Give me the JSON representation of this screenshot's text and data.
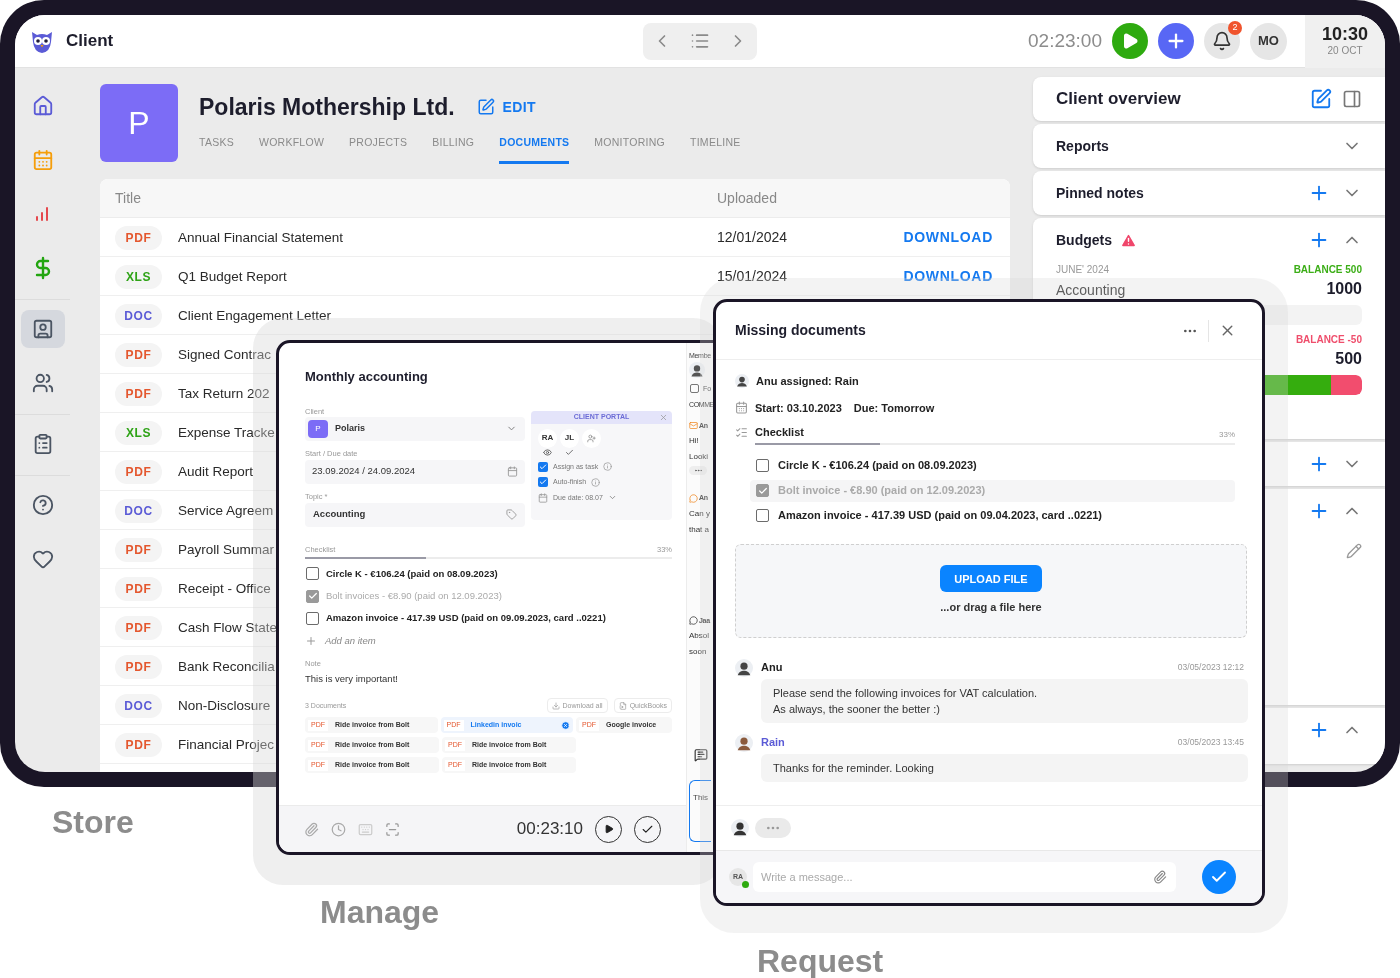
{
  "app": {
    "title": "Client",
    "timer": "02:23:00",
    "notifications": "2",
    "user_initials": "MO",
    "clock": {
      "time": "10:30",
      "date": "20 OCT"
    }
  },
  "sidebar": {
    "groups": [
      {
        "items": [
          {
            "kind": "home",
            "selected": false
          },
          {
            "kind": "calendar",
            "selected": false
          },
          {
            "kind": "chart",
            "selected": false
          },
          {
            "kind": "money",
            "selected": false
          }
        ]
      },
      {
        "items": [
          {
            "kind": "contact",
            "selected": true
          },
          {
            "kind": "people",
            "selected": false
          }
        ]
      },
      {
        "items": [
          {
            "kind": "clipboard",
            "selected": false
          }
        ]
      },
      {
        "items": [
          {
            "kind": "help",
            "selected": false
          },
          {
            "kind": "heart",
            "selected": false
          }
        ]
      }
    ]
  },
  "client": {
    "initial": "P",
    "name": "Polaris Mothership Ltd.",
    "edit": "EDIT",
    "tabs": [
      {
        "label": "TASKS",
        "selected": false
      },
      {
        "label": "WORKFLOW",
        "selected": false
      },
      {
        "label": "PROJECTS",
        "selected": false
      },
      {
        "label": "BILLING",
        "selected": false
      },
      {
        "label": "DOCUMENTS",
        "selected": true
      },
      {
        "label": "MONITORING",
        "selected": false
      },
      {
        "label": "TIMELINE",
        "selected": false
      }
    ]
  },
  "documents": {
    "columns": [
      "Title",
      "Uploaded"
    ],
    "rows": [
      {
        "kind": "pdf",
        "type": "PDF",
        "title": "Annual Financial Statement",
        "uploaded": "12/01/2024",
        "action": "DOWNLOAD"
      },
      {
        "kind": "xls",
        "type": "XLS",
        "title": "Q1 Budget Report",
        "uploaded": "15/01/2024",
        "action": "DOWNLOAD"
      },
      {
        "kind": "doc",
        "type": "DOC",
        "title": "Client Engagement Letter"
      },
      {
        "kind": "pdf",
        "type": "PDF",
        "title": "Signed Contrac"
      },
      {
        "kind": "pdf",
        "type": "PDF",
        "title": "Tax Return 202"
      },
      {
        "kind": "xls",
        "type": "XLS",
        "title": "Expense Tracke"
      },
      {
        "kind": "pdf",
        "type": "PDF",
        "title": "Audit Report"
      },
      {
        "kind": "doc",
        "type": "DOC",
        "title": "Service Agreem"
      },
      {
        "kind": "pdf",
        "type": "PDF",
        "title": "Payroll Summar"
      },
      {
        "kind": "pdf",
        "type": "PDF",
        "title": "Receipt - Office"
      },
      {
        "kind": "pdf",
        "type": "PDF",
        "title": "Cash Flow State"
      },
      {
        "kind": "pdf",
        "type": "PDF",
        "title": "Bank Reconcilia"
      },
      {
        "kind": "doc",
        "type": "DOC",
        "title": "Non-Disclosure"
      },
      {
        "kind": "pdf",
        "type": "PDF",
        "title": "Financial Projec"
      }
    ]
  },
  "overview": {
    "title": "Client overview",
    "sections": [
      {
        "kind": "plain",
        "title": "Reports",
        "expanded": false,
        "addable": false
      },
      {
        "kind": "plain",
        "title": "Pinned notes",
        "expanded": false,
        "addable": true
      },
      {
        "kind": "budgets",
        "title": "Budgets",
        "warning": true,
        "expanded": true,
        "addable": true,
        "items": [
          {
            "period": "JUNE' 2024",
            "name": "Accounting",
            "balance": "BALANCE 500",
            "amount": "1000",
            "negative": false
          },
          {
            "balance": "BALANCE -50",
            "amount": "500",
            "negative": true,
            "level": 0.9
          }
        ]
      },
      {
        "kind": "plain",
        "expanded": false,
        "addable": true
      },
      {
        "kind": "plain",
        "expanded": true,
        "addable": true,
        "editable": true
      },
      {
        "kind": "plain",
        "expanded": true,
        "addable": true
      }
    ]
  },
  "task": {
    "title": "Monthly accounting",
    "client_label": "Client",
    "client": {
      "initial": "P",
      "name": "Polaris"
    },
    "date_label": "Start / Due date",
    "dates": "23.09.2024 / 24.09.2024",
    "topic_label": "Topic *",
    "topic": "Accounting",
    "portal": {
      "title": "CLIENT PORTAL",
      "members": [
        {
          "initials": "RA",
          "kind": "viewed"
        },
        {
          "initials": "JL",
          "kind": "done"
        }
      ],
      "options": [
        {
          "label": "Assign as task",
          "checked": true
        },
        {
          "label": "Auto-finish",
          "checked": true
        }
      ],
      "due": "Due date: 08.07"
    },
    "checklist": {
      "label": "Checklist",
      "percent": "33%",
      "level": 0.33,
      "items": [
        {
          "text": "Circle K - €106.24 (paid on 08.09.2023)",
          "checked": false
        },
        {
          "text": "Bolt invoices - €8.90 (paid on 12.09.2023)",
          "checked": true
        },
        {
          "text": "Amazon invoice - 417.39 USD (paid on 09.09.2023, card ..0221)",
          "checked": false
        }
      ],
      "add": "Add an item"
    },
    "note_label": "Note",
    "note": "This is very important!",
    "files": {
      "count": "3 Documents",
      "actions": [
        {
          "kind": "download",
          "label": "Download all"
        },
        {
          "kind": "export",
          "label": "QuickBooks"
        }
      ],
      "rows": [
        {
          "items": [
            {
              "type": "PDF",
              "name": "Ride invoice from Bolt",
              "highlighted": false
            },
            {
              "type": "PDF",
              "name": "Linkedin invoic",
              "highlighted": true
            },
            {
              "type": "PDF",
              "name": "Google invoice",
              "highlighted": false
            }
          ]
        },
        {
          "items": [
            {
              "type": "PDF",
              "name": "Ride invoice from Bolt",
              "highlighted": false
            },
            {
              "type": "PDF",
              "name": "Ride invoice from Bolt",
              "highlighted": false
            }
          ]
        },
        {
          "items": [
            {
              "type": "PDF",
              "name": "Ride invoice from Bolt",
              "highlighted": false
            },
            {
              "type": "PDF",
              "name": "Ride invoice from Bolt",
              "highlighted": false
            }
          ]
        }
      ]
    },
    "timer": "00:23:10",
    "side": {
      "label": "Membe",
      "option": "Fo",
      "option_checked": false,
      "section": "COMME",
      "comments": [
        {
          "kind": "mail",
          "author": "An",
          "lines": [
            "Hi!",
            "Looki"
          ],
          "more": true
        },
        {
          "kind": "comment",
          "author": "An",
          "lines": [
            "Can y",
            "that a"
          ],
          "more": false
        },
        {
          "kind": "comment",
          "author": "Jaa",
          "lines": [
            "Absol",
            "soon"
          ],
          "more": false
        }
      ],
      "input": "This"
    }
  },
  "request": {
    "title": "Missing documents",
    "assigned": "Anu assigned: Rain",
    "start": "Start: 03.10.2023",
    "due": "Due: Tomorrow",
    "checklist": {
      "label": "Checklist",
      "percent": "33%",
      "level": 0.26,
      "items": [
        {
          "text": "Circle K - €106.24 (paid on 08.09.2023)",
          "checked": false
        },
        {
          "text": "Bolt invoice - €8.90 (paid on 12.09.2023)",
          "checked": true
        },
        {
          "text": "Amazon invoice - 417.39 USD (paid on 09.04.2023, card ..0221)",
          "checked": false
        }
      ]
    },
    "upload": {
      "button": "UPLOAD FILE",
      "hint": "...or drag a file here"
    },
    "messages": [
      {
        "author": "Anu",
        "self": false,
        "time": "03/05/2023 12:12",
        "lines": [
          "Please send the following invoices for VAT calculation.",
          "As always, the sooner the better :)"
        ]
      },
      {
        "author": "Rain",
        "self": true,
        "time": "03/05/2023 13:45",
        "lines": [
          "Thanks for the reminder. Looking"
        ]
      }
    ],
    "typing": true,
    "composer": {
      "initials": "RA",
      "online": true,
      "placeholder": "Write a message..."
    }
  },
  "captions": [
    "Store",
    "Manage",
    "Request"
  ]
}
